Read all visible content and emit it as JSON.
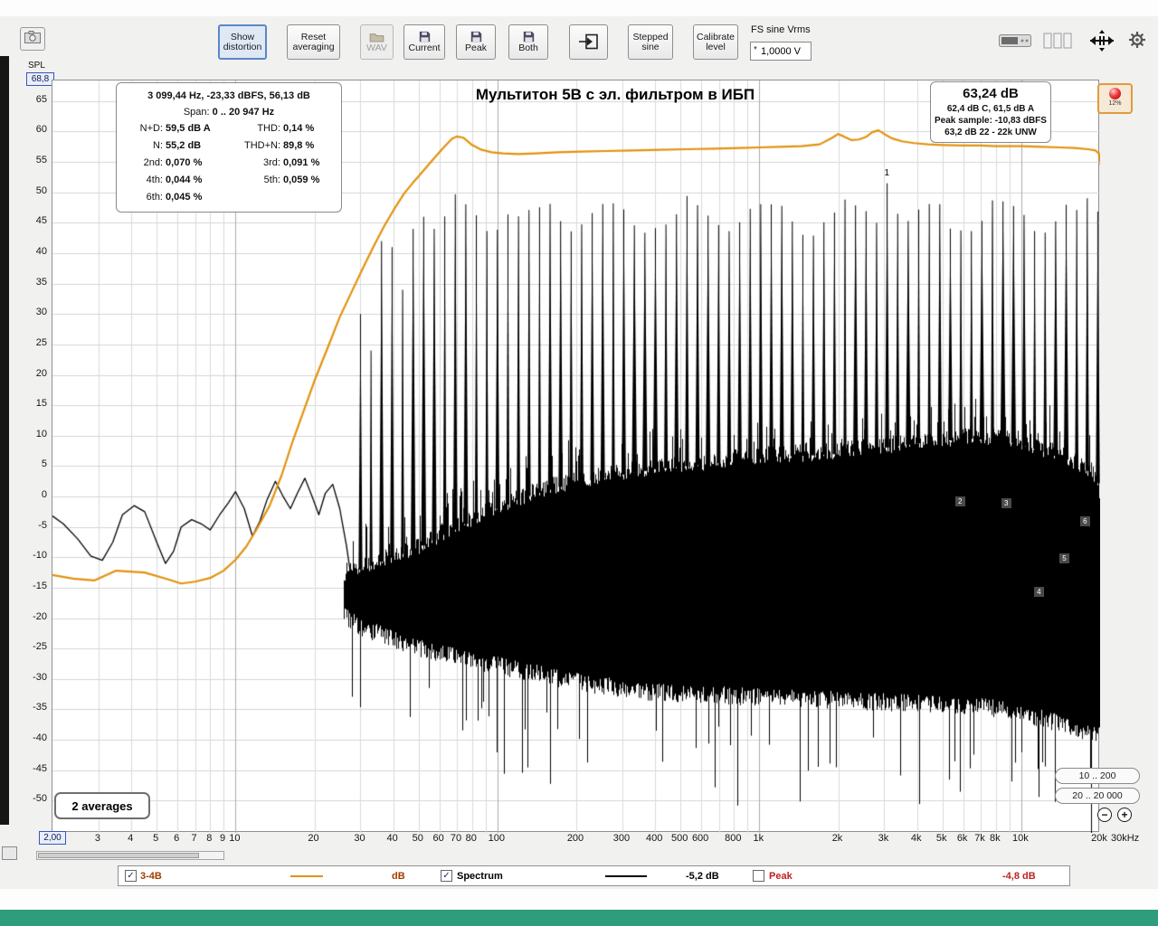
{
  "icons": {
    "plus": "+",
    "minus": "−",
    "check": "✓",
    "dropdown_arrow": "▼",
    "spinner_arrow": "▼"
  },
  "colors": {
    "orange_curve": "#e2920e",
    "spectrum_black": "#000000",
    "legend_series1_text": "#a33c00",
    "legend_peak_red": "#c22020",
    "bottom_bar_green": "#2f9c7c",
    "record_red": "#e03030"
  },
  "toolbar": {
    "buttons": {
      "show_distortion": "Show distortion",
      "reset_averaging": "Reset averaging",
      "wav": "WAV",
      "current": "Current",
      "peak": "Peak",
      "both": "Both",
      "stepped_sine": "Stepped sine",
      "calibrate_level": "Calibrate level"
    },
    "fs_sine_label": "FS sine Vrms",
    "fs_sine_value": "1,0000 V"
  },
  "left_panel": {
    "spl_label": "SPL",
    "max_db": "68,8",
    "selector_value": "SPL"
  },
  "chart": {
    "title": "Мультитон 5В с эл. фильтром в ИБП",
    "cursor_info": {
      "line1": "3 099,44 Hz, -23,33 dBFS, 56,13 dB",
      "span_label": "Span:",
      "span_value": "0 .. 20 947 Hz",
      "rows": [
        {
          "l1": "N+D:",
          "v1": "59,5 dB A",
          "l2": "THD:",
          "v2": "0,14 %"
        },
        {
          "l1": "N:",
          "v1": "55,2 dB",
          "l2": "THD+N:",
          "v2": "89,8 %"
        },
        {
          "l1": "2nd:",
          "v1": "0,070 %",
          "l2": "3rd:",
          "v2": "0,091 %"
        },
        {
          "l1": "4th:",
          "v1": "0,044 %",
          "l2": "5th:",
          "v2": "0,059 %"
        },
        {
          "l1": "6th:",
          "v1": "0,045 %",
          "l2": "",
          "v2": ""
        }
      ]
    },
    "level_info": {
      "big": "63,24 dB",
      "line2": "62,4 dB C, 61,5 dB A",
      "line3": "Peak sample: -10,83 dBFS",
      "line4": "63,2 dB 22 - 22k UNW"
    },
    "record_button_pct": "12%",
    "averages": "2 averages",
    "range_buttons": [
      "10 .. 200",
      "20 .. 20 000"
    ],
    "axis": {
      "y_ticks": [
        65,
        60,
        55,
        50,
        45,
        40,
        35,
        30,
        25,
        20,
        15,
        10,
        5,
        0,
        -5,
        -10,
        -15,
        -20,
        -25,
        -30,
        -35,
        -40,
        -45,
        -50
      ],
      "x_start_label": "2,00",
      "x_end_label": "30kHz",
      "x_ticks": [
        {
          "f": 3,
          "l": "3"
        },
        {
          "f": 4,
          "l": "4"
        },
        {
          "f": 5,
          "l": "5"
        },
        {
          "f": 6,
          "l": "6"
        },
        {
          "f": 7,
          "l": "7"
        },
        {
          "f": 8,
          "l": "8"
        },
        {
          "f": 9,
          "l": "9"
        },
        {
          "f": 10,
          "l": "10"
        },
        {
          "f": 20,
          "l": "20"
        },
        {
          "f": 30,
          "l": "30"
        },
        {
          "f": 40,
          "l": "40"
        },
        {
          "f": 50,
          "l": "50"
        },
        {
          "f": 60,
          "l": "60"
        },
        {
          "f": 70,
          "l": "70"
        },
        {
          "f": 80,
          "l": "80"
        },
        {
          "f": 100,
          "l": "100"
        },
        {
          "f": 200,
          "l": "200"
        },
        {
          "f": 300,
          "l": "300"
        },
        {
          "f": 400,
          "l": "400"
        },
        {
          "f": 500,
          "l": "500"
        },
        {
          "f": 600,
          "l": "600"
        },
        {
          "f": 800,
          "l": "800"
        },
        {
          "f": 1000,
          "l": "1k"
        },
        {
          "f": 2000,
          "l": "2k"
        },
        {
          "f": 3000,
          "l": "3k"
        },
        {
          "f": 4000,
          "l": "4k"
        },
        {
          "f": 5000,
          "l": "5k"
        },
        {
          "f": 6000,
          "l": "6k"
        },
        {
          "f": 7000,
          "l": "7k"
        },
        {
          "f": 8000,
          "l": "8k"
        },
        {
          "f": 10000,
          "l": "10k"
        },
        {
          "f": 20000,
          "l": "20k"
        }
      ]
    }
  },
  "legend": {
    "series1": {
      "label": "3-4B",
      "unit": "dB",
      "checked": true
    },
    "series2": {
      "label": "Spectrum",
      "value": "-5,2 dB",
      "checked": true
    },
    "series3": {
      "label": "Peak",
      "value": "-4,8 dB",
      "checked": false
    }
  },
  "chart_data": {
    "type": "line",
    "x_axis": {
      "scale": "log",
      "min_hz": 2,
      "max_hz": 20000,
      "label": "Hz"
    },
    "y_axis": {
      "unit": "dB",
      "min": -55.3,
      "max": 68.4,
      "grid_step": 5
    },
    "v_gridlines": [
      3,
      4,
      5,
      6,
      7,
      8,
      9,
      10,
      20,
      30,
      40,
      50,
      60,
      70,
      80,
      90,
      100,
      200,
      300,
      400,
      500,
      600,
      700,
      800,
      900,
      1000,
      2000,
      3000,
      4000,
      5000,
      6000,
      7000,
      8000,
      9000,
      10000,
      20000
    ],
    "v_major": [
      10,
      100,
      1000,
      10000
    ],
    "orange_curve": {
      "name": "3-4B",
      "color": "#e2920e",
      "points": [
        [
          2,
          -12.9
        ],
        [
          2.4,
          -13.5
        ],
        [
          2.9,
          -13.8
        ],
        [
          3.5,
          -12.2
        ],
        [
          4.5,
          -12.5
        ],
        [
          5.5,
          -13.6
        ],
        [
          6.2,
          -14.3
        ],
        [
          7,
          -14.0
        ],
        [
          8,
          -13.4
        ],
        [
          9,
          -12.2
        ],
        [
          10,
          -10.4
        ],
        [
          11,
          -8.2
        ],
        [
          12,
          -5.5
        ],
        [
          13.5,
          -1.5
        ],
        [
          15,
          3.5
        ],
        [
          16.5,
          9
        ],
        [
          18,
          13.5
        ],
        [
          20,
          19
        ],
        [
          22.5,
          24.5
        ],
        [
          25,
          29.5
        ],
        [
          28,
          34
        ],
        [
          31,
          38
        ],
        [
          34,
          41.5
        ],
        [
          37,
          44.5
        ],
        [
          40,
          47
        ],
        [
          44,
          49.8
        ],
        [
          48,
          51.8
        ],
        [
          52,
          53.5
        ],
        [
          57,
          55.5
        ],
        [
          62,
          57.3
        ],
        [
          67,
          58.8
        ],
        [
          70,
          59.2
        ],
        [
          74,
          59.0
        ],
        [
          80,
          57.8
        ],
        [
          87,
          57.0
        ],
        [
          95,
          56.6
        ],
        [
          105,
          56.4
        ],
        [
          120,
          56.3
        ],
        [
          140,
          56.4
        ],
        [
          170,
          56.6
        ],
        [
          210,
          56.7
        ],
        [
          260,
          56.8
        ],
        [
          330,
          56.9
        ],
        [
          420,
          57.0
        ],
        [
          530,
          57.1
        ],
        [
          680,
          57.2
        ],
        [
          850,
          57.3
        ],
        [
          1000,
          57.4
        ],
        [
          1200,
          57.5
        ],
        [
          1450,
          57.6
        ],
        [
          1700,
          57.9
        ],
        [
          1900,
          59.0
        ],
        [
          2000,
          59.6
        ],
        [
          2100,
          59.2
        ],
        [
          2250,
          58.6
        ],
        [
          2400,
          58.7
        ],
        [
          2550,
          59.1
        ],
        [
          2700,
          59.9
        ],
        [
          2850,
          60.2
        ],
        [
          3000,
          59.6
        ],
        [
          3200,
          58.9
        ],
        [
          3500,
          58.4
        ],
        [
          3900,
          58.1
        ],
        [
          4400,
          57.9
        ],
        [
          5000,
          57.8
        ],
        [
          6000,
          57.7
        ],
        [
          7000,
          57.7
        ],
        [
          8000,
          57.6
        ],
        [
          9000,
          57.6
        ],
        [
          10000,
          57.6
        ],
        [
          12000,
          57.5
        ],
        [
          14000,
          57.4
        ],
        [
          16000,
          57.3
        ],
        [
          18000,
          57.1
        ],
        [
          19200,
          56.9
        ],
        [
          19800,
          56.4
        ],
        [
          20300,
          53.5
        ],
        [
          20600,
          51.5
        ]
      ]
    },
    "lowfreq_trace": {
      "color": "#000000",
      "points": [
        [
          2,
          -3.2
        ],
        [
          2.2,
          -4.5
        ],
        [
          2.5,
          -7
        ],
        [
          2.8,
          -9.8
        ],
        [
          3.1,
          -10.5
        ],
        [
          3.4,
          -7.5
        ],
        [
          3.7,
          -3
        ],
        [
          4.1,
          -1.5
        ],
        [
          4.5,
          -2.5
        ],
        [
          5,
          -7.5
        ],
        [
          5.4,
          -11
        ],
        [
          5.8,
          -9
        ],
        [
          6.2,
          -5
        ],
        [
          6.8,
          -3.8
        ],
        [
          7.4,
          -4.5
        ],
        [
          8,
          -5.5
        ],
        [
          8.7,
          -3
        ],
        [
          9.4,
          -1
        ],
        [
          10,
          0.8
        ],
        [
          10.8,
          -2
        ],
        [
          11.6,
          -6.5
        ],
        [
          12.4,
          -4
        ],
        [
          13.2,
          -0.5
        ],
        [
          14.2,
          2.5
        ],
        [
          15.2,
          0
        ],
        [
          16.2,
          -2
        ],
        [
          17.2,
          0.5
        ],
        [
          18.4,
          3
        ],
        [
          19.6,
          0
        ],
        [
          20.8,
          -3
        ],
        [
          22,
          0.5
        ],
        [
          23.5,
          2
        ],
        [
          25,
          -2
        ],
        [
          26.5,
          -8
        ],
        [
          28,
          -15
        ],
        [
          29,
          -19
        ]
      ]
    },
    "noise_envelope": {
      "top": [
        [
          26,
          -14
        ],
        [
          30,
          -13
        ],
        [
          40,
          -11
        ],
        [
          50,
          -9.5
        ],
        [
          65,
          -7
        ],
        [
          80,
          -5
        ],
        [
          100,
          -3
        ],
        [
          130,
          -1
        ],
        [
          170,
          0.5
        ],
        [
          250,
          2
        ],
        [
          400,
          3.5
        ],
        [
          700,
          4.5
        ],
        [
          1200,
          5.5
        ],
        [
          2000,
          6
        ],
        [
          3000,
          7
        ],
        [
          4500,
          8
        ],
        [
          6500,
          8.5
        ],
        [
          9000,
          8
        ],
        [
          12000,
          6.5
        ],
        [
          15000,
          5
        ],
        [
          17500,
          3.5
        ],
        [
          19500,
          2
        ],
        [
          20000,
          -2
        ]
      ],
      "bottom": [
        [
          26,
          -18
        ],
        [
          30,
          -20
        ],
        [
          40,
          -22
        ],
        [
          55,
          -24
        ],
        [
          80,
          -25.5
        ],
        [
          120,
          -27
        ],
        [
          200,
          -29
        ],
        [
          350,
          -30.5
        ],
        [
          600,
          -31
        ],
        [
          1000,
          -31.5
        ],
        [
          2000,
          -32
        ],
        [
          4000,
          -32.5
        ],
        [
          7000,
          -33
        ],
        [
          10000,
          -34
        ],
        [
          13000,
          -35.5
        ],
        [
          16000,
          -36.5
        ],
        [
          19000,
          -37.5
        ],
        [
          20000,
          -38
        ]
      ]
    },
    "multitone": {
      "f_start": 30,
      "f_end": 19600,
      "count": 71,
      "level_base": 46.3,
      "level_wobble": 2.2,
      "level_jitter": 1.5,
      "intro_levels": [
        30,
        24,
        42,
        41,
        34,
        44,
        46,
        44
      ],
      "fundamental": {
        "f": 3099.44,
        "db": 51.5
      }
    },
    "markers": [
      {
        "n": "1",
        "f": 3099,
        "db": 52.0,
        "style": "plain"
      },
      {
        "n": "2",
        "f": 6199,
        "db": -0.9,
        "style": "box"
      },
      {
        "n": "3",
        "f": 9298,
        "db": -1.2,
        "style": "box"
      },
      {
        "n": "4",
        "f": 12398,
        "db": -15.9,
        "style": "box"
      },
      {
        "n": "5",
        "f": 15497,
        "db": -10.3,
        "style": "box"
      },
      {
        "n": "6",
        "f": 18596,
        "db": -4.3,
        "style": "box"
      }
    ]
  }
}
